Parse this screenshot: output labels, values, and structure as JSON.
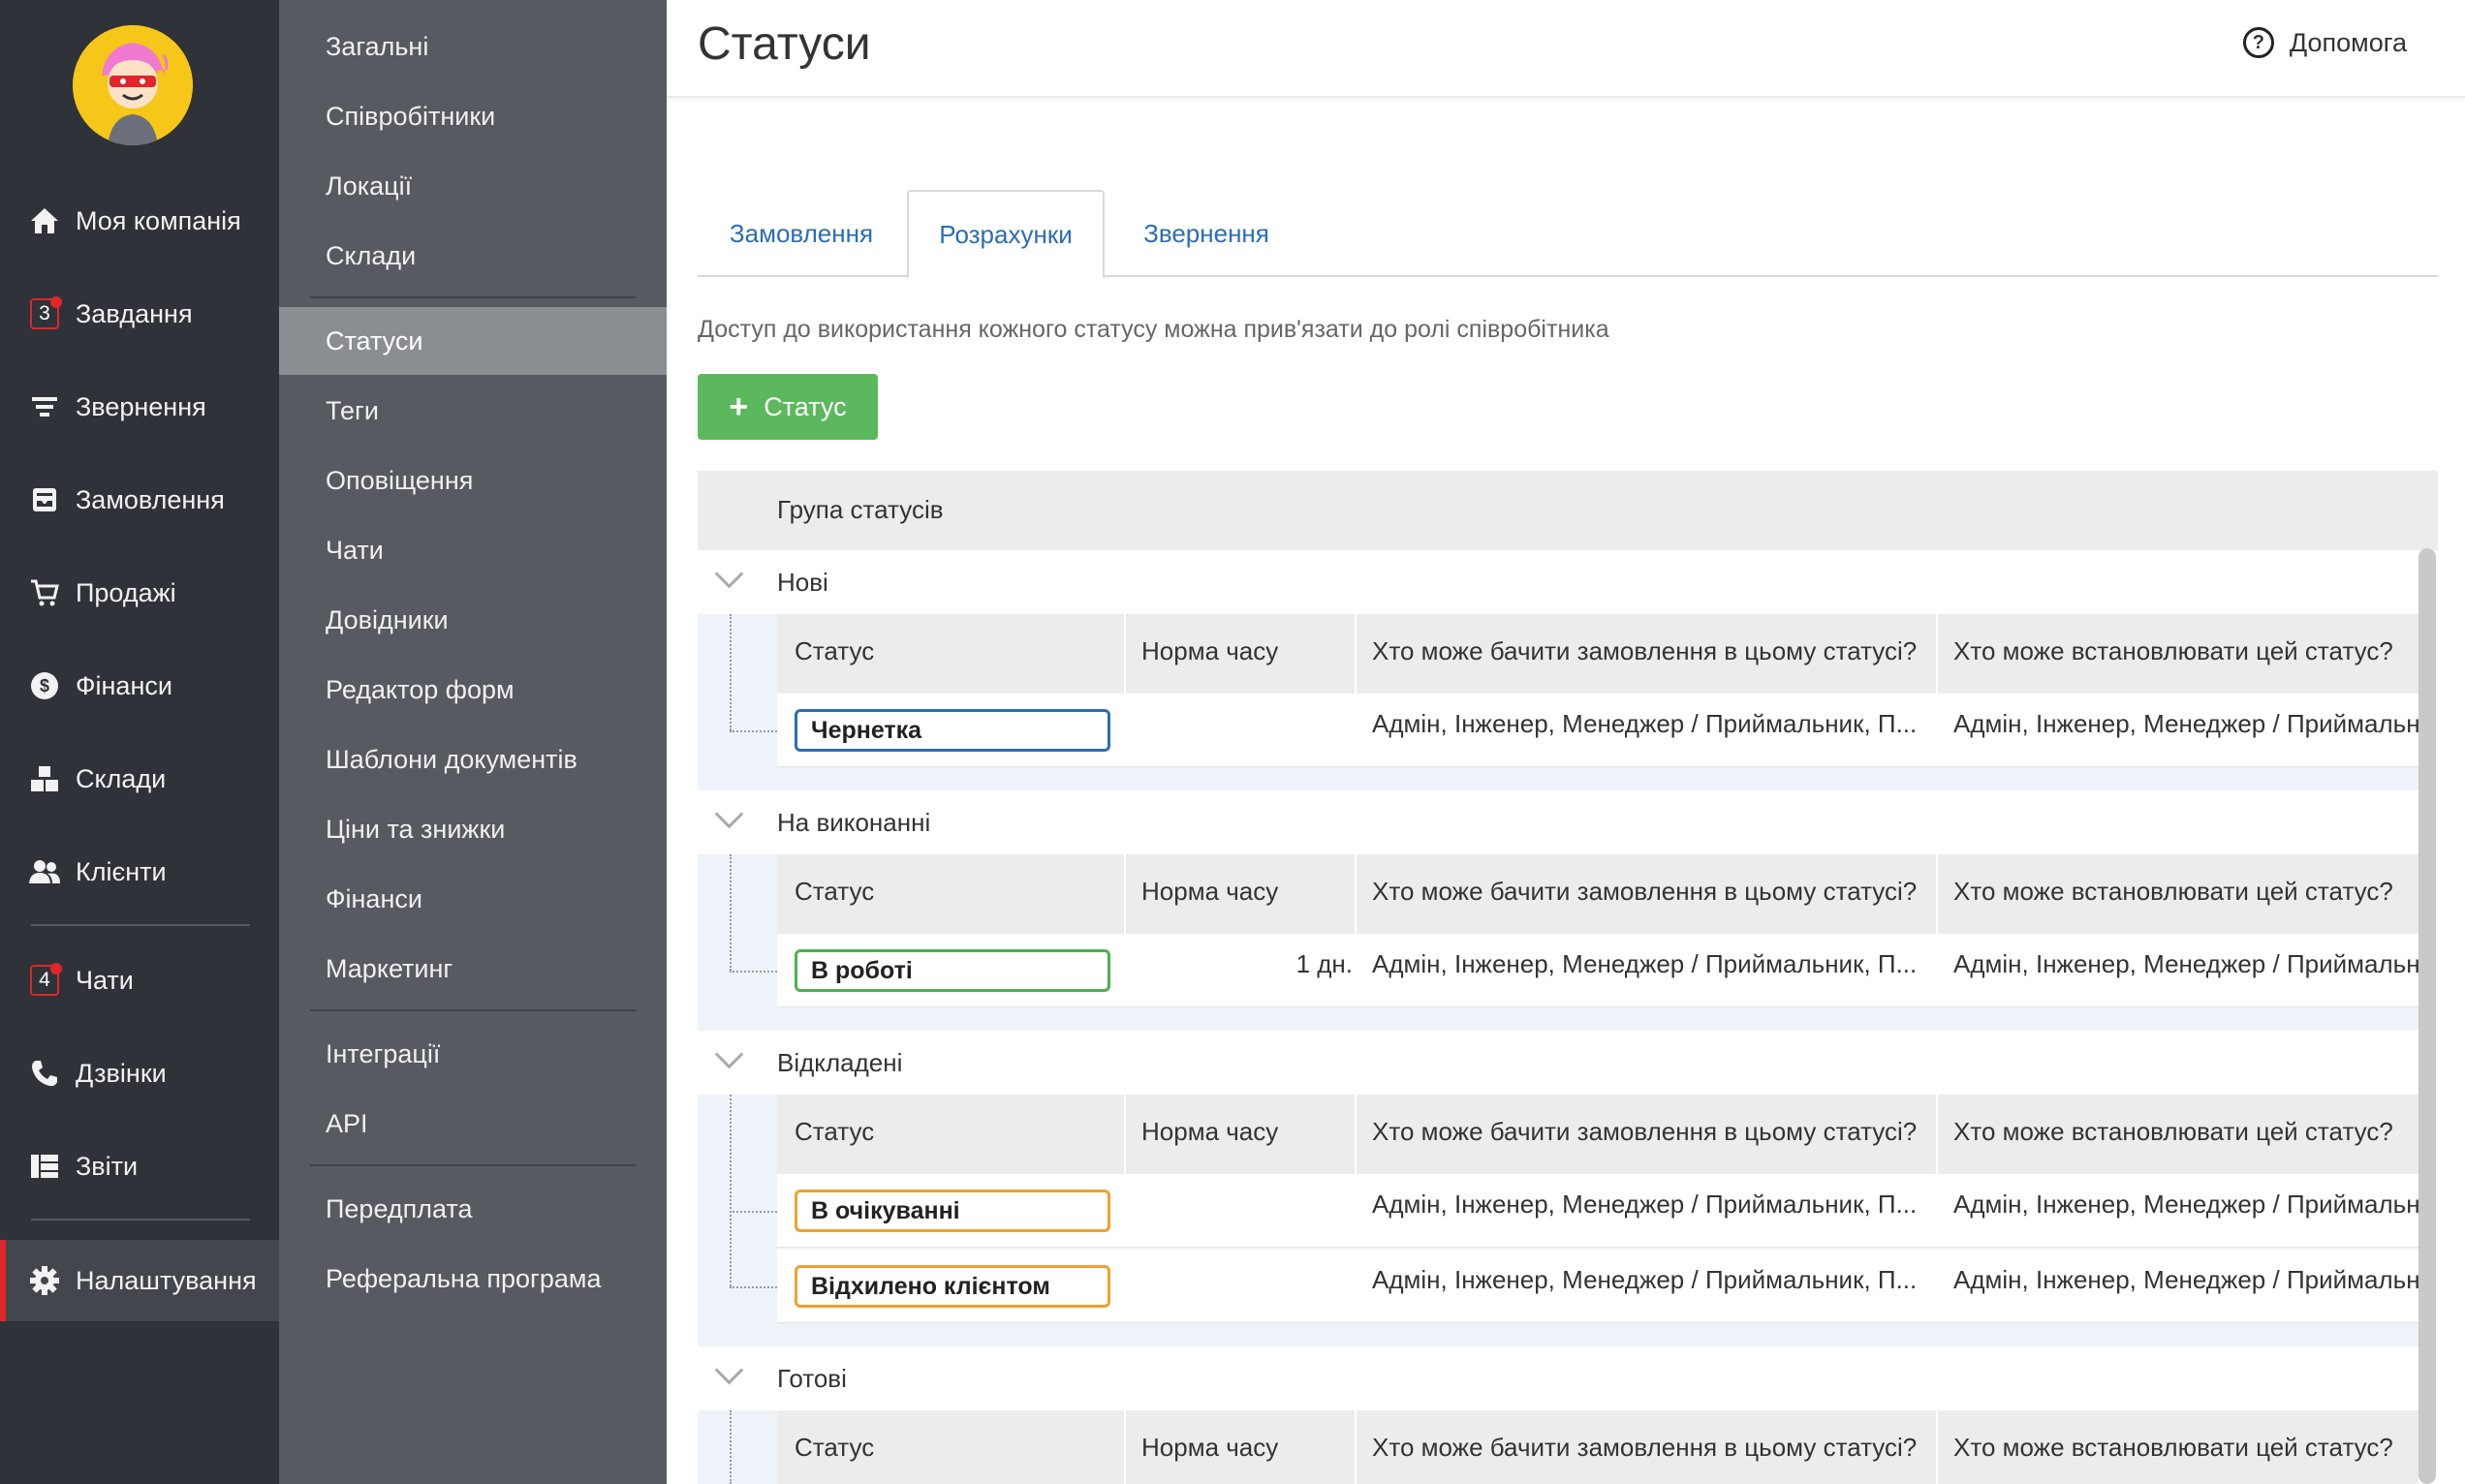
{
  "nav": {
    "items": [
      {
        "label": "Моя компанія",
        "icon": "home-icon"
      },
      {
        "label": "Завдання",
        "icon": "tasks-icon",
        "badge": "3"
      },
      {
        "label": "Звернення",
        "icon": "filter-icon"
      },
      {
        "label": "Замовлення",
        "icon": "orders-icon"
      },
      {
        "label": "Продажі",
        "icon": "cart-icon"
      },
      {
        "label": "Фінанси",
        "icon": "dollar-icon"
      },
      {
        "label": "Склади",
        "icon": "boxes-icon"
      },
      {
        "label": "Клієнти",
        "icon": "users-icon"
      },
      {
        "label": "Чати",
        "icon": "chat-icon",
        "badge": "4"
      },
      {
        "label": "Дзвінки",
        "icon": "phone-icon"
      },
      {
        "label": "Звіти",
        "icon": "reports-icon"
      },
      {
        "label": "Налаштування",
        "icon": "gear-icon",
        "active": true
      }
    ]
  },
  "subnav": {
    "items": [
      "Загальні",
      "Співробітники",
      "Локації",
      "Склади",
      "Статуси",
      "Теги",
      "Оповіщення",
      "Чати",
      "Довідники",
      "Редактор форм",
      "Шаблони документів",
      "Ціни та знижки",
      "Фінанси",
      "Маркетинг",
      "Інтеграції",
      "API",
      "Передплата",
      "Реферальна програма"
    ],
    "active": "Статуси"
  },
  "header": {
    "title": "Статуси",
    "help_label": "Допомога"
  },
  "tabs": [
    {
      "label": "Замовлення"
    },
    {
      "label": "Розрахунки",
      "active": true
    },
    {
      "label": "Звернення"
    }
  ],
  "hint": "Доступ до використання кожного статусу можна прив'язати до ролі співробітника",
  "add_button": {
    "label": "Статус"
  },
  "table": {
    "group_header": "Група статусів",
    "columns": [
      "Статус",
      "Норма часу",
      "Хто може бачити замовлення в цьому статусі?",
      "Хто може встановлювати цей статус?"
    ],
    "groups": [
      {
        "name": "Нові",
        "rows": [
          {
            "status": "Чернетка",
            "color": "#2a6db4",
            "time": "",
            "see": "Адмін, Інженер, Менеджер / Приймальник, П...",
            "set": "Адмін, Інженер, Менеджер / Приймальник"
          }
        ]
      },
      {
        "name": "На виконанні",
        "rows": [
          {
            "status": "В роботі",
            "color": "#4caf50",
            "time": "1 дн.",
            "see": "Адмін, Інженер, Менеджер / Приймальник, П...",
            "set": "Адмін, Інженер, Менеджер / Приймальник"
          }
        ]
      },
      {
        "name": "Відкладені",
        "rows": [
          {
            "status": "В очікуванні",
            "color": "#f0a030",
            "time": "",
            "see": "Адмін, Інженер, Менеджер / Приймальник, П...",
            "set": "Адмін, Інженер, Менеджер / Приймальник"
          },
          {
            "status": "Відхилено клієнтом",
            "color": "#f0a030",
            "time": "",
            "see": "Адмін, Інженер, Менеджер / Приймальник, П...",
            "set": "Адмін, Інженер, Менеджер / Приймальник"
          }
        ]
      },
      {
        "name": "Готові",
        "rows": []
      }
    ]
  }
}
